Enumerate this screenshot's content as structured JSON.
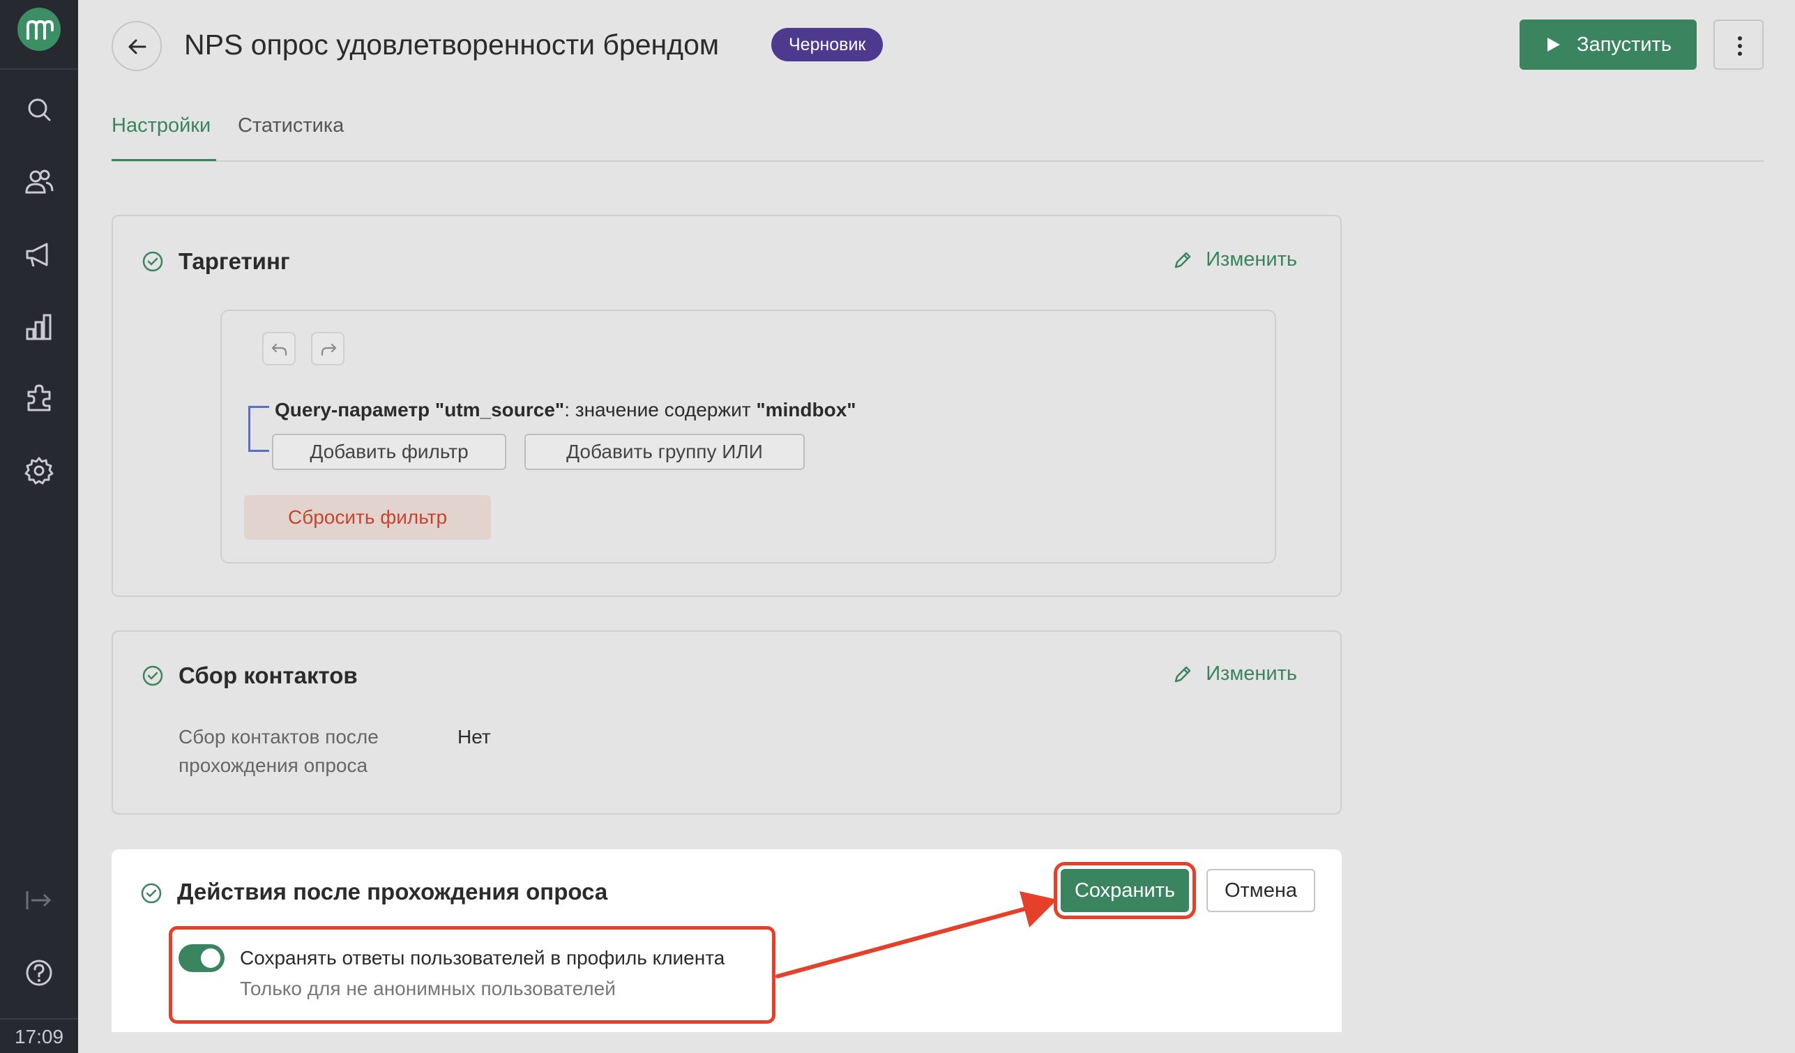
{
  "sidebar": {
    "logo_letter": "m",
    "nav": [
      "search-icon",
      "users-icon",
      "campaigns-icon",
      "analytics-icon",
      "integrations-icon",
      "settings-icon"
    ],
    "bottom": [
      "collapse-icon",
      "help-icon"
    ],
    "clock": "17:09"
  },
  "header": {
    "title": "NPS опрос удовлетворенности брендом",
    "status": "Черновик",
    "run_label": "Запустить"
  },
  "tabs": {
    "settings": "Настройки",
    "stats": "Статистика"
  },
  "targeting": {
    "title": "Таргетинг",
    "edit_label": "Изменить",
    "filter": {
      "param_name": "Query-параметр \"utm_source\"",
      "condition": ": значение содержит ",
      "value": "\"mindbox\""
    },
    "add_filter_label": "Добавить фильтр",
    "add_or_group_label": "Добавить группу ИЛИ",
    "reset_filter_label": "Сбросить фильтр"
  },
  "contacts": {
    "title": "Сбор контактов",
    "edit_label": "Изменить",
    "field_label": "Сбор контактов после прохождения опроса",
    "field_value": "Нет"
  },
  "actions": {
    "title": "Действия после прохождения опроса",
    "save_label": "Сохранить",
    "cancel_label": "Отмена",
    "toggle_label": "Сохранять ответы пользователей в профиль клиента",
    "toggle_hint": "Только для не анонимных пользователей",
    "toggle_on": true
  },
  "colors": {
    "accent": "#3a8560",
    "badge": "#4d3a8f",
    "annotation": "#e4402a",
    "sidebar": "#262a30"
  }
}
